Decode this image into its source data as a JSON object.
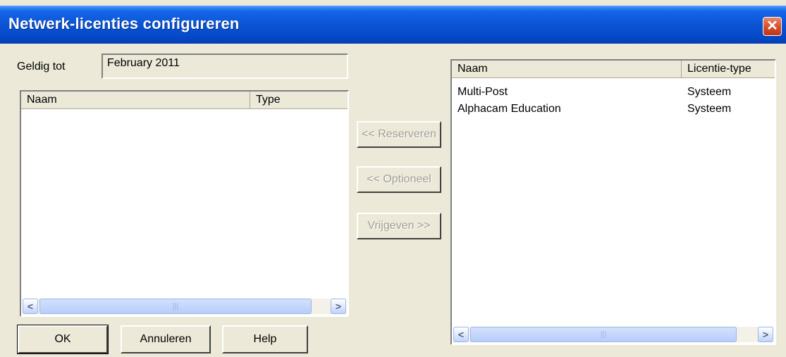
{
  "window": {
    "title": "Netwerk-licenties configureren",
    "close_glyph": "✕"
  },
  "valid": {
    "label": "Geldig tot",
    "value": "February 2011"
  },
  "left_list": {
    "columns": [
      "Naam",
      "Type"
    ],
    "rows": []
  },
  "actions": {
    "reserve_label": "<< Reserveren",
    "optional_label": "<< Optioneel",
    "release_label": "Vrijgeven >>"
  },
  "right_list": {
    "columns": [
      "Naam",
      "Licentie-type"
    ],
    "rows": [
      {
        "name": "Multi-Post",
        "type": "Systeem"
      },
      {
        "name": "Alphacam Education",
        "type": "Systeem"
      }
    ]
  },
  "scrollbar": {
    "left_arrow": "<",
    "right_arrow": ">",
    "grip": "|||"
  },
  "buttons": {
    "ok_label": "OK",
    "cancel_label": "Annuleren",
    "help_label": "Help"
  },
  "colors": {
    "titlebar": "#0a54d4",
    "face": "#ece9d8",
    "close": "#d24a25"
  }
}
